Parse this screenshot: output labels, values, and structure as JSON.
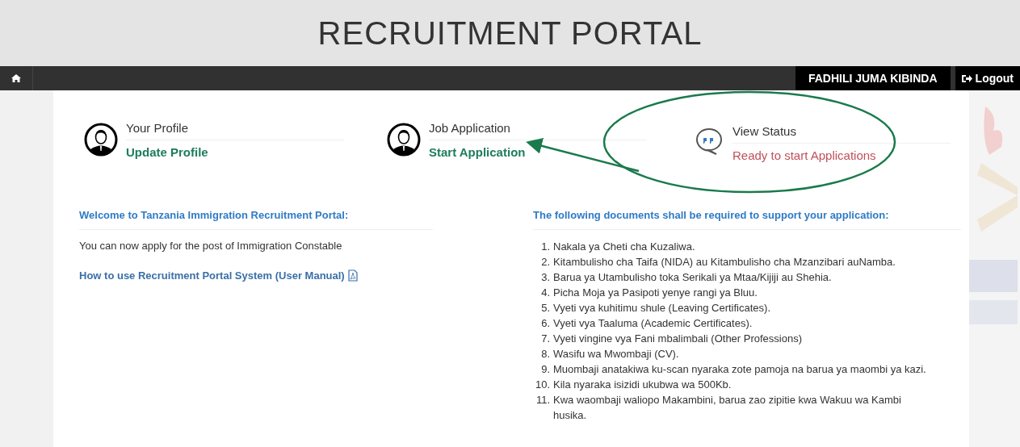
{
  "header": {
    "title": "RECRUITMENT PORTAL"
  },
  "navbar": {
    "user": "FADHILI JUMA KIBINDA",
    "logout": "Logout"
  },
  "cards": [
    {
      "kind": "profile",
      "title": "Your Profile",
      "action": "Update Profile"
    },
    {
      "kind": "profile",
      "title": "Job Application",
      "action": "Start Application"
    },
    {
      "kind": "status",
      "title": "View Status",
      "action": "Ready to start Applications"
    }
  ],
  "welcome": {
    "heading": "Welcome to Tanzania Immigration Recruitment Portal:",
    "text": "You can now apply for the post of Immigration Constable",
    "manual_link": "How to use Recruitment Portal System (User Manual)"
  },
  "documents": {
    "heading": "The following documents shall be required to support your application:",
    "items": [
      {
        "number": "1.",
        "text": "Nakala ya Cheti cha Kuzaliwa."
      },
      {
        "number": "2.",
        "text": "Kitambulisho cha Taifa (NIDA) au Kitambulisho cha Mzanzibari auNamba."
      },
      {
        "number": "3.",
        "text": "Barua ya Utambulisho toka Serikali ya Mtaa/Kijiji au Shehia."
      },
      {
        "number": "4.",
        "text": "Picha Moja ya Pasipoti yenye rangi ya Bluu."
      },
      {
        "number": "5.",
        "text": "Vyeti vya kuhitimu shule (Leaving Certificates)."
      },
      {
        "number": "6.",
        "text": "Vyeti vya Taaluma (Academic Certificates)."
      },
      {
        "number": "7.",
        "text": "Vyeti vingine vya Fani mbalimbali (Other Professions)"
      },
      {
        "number": "8.",
        "text": "Wasifu wa Mwombaji (CV)."
      },
      {
        "number": "9.",
        "text": "Muombaji anatakiwa ku-scan nyaraka zote pamoja na barua ya maombi ya kazi."
      },
      {
        "number": "10.",
        "text": "Kila nyaraka isizidi ukubwa wa 500Kb."
      },
      {
        "number": "11.",
        "text": "Kwa waombaji waliopo Makambini, barua zao zipitie kwa Wakuu wa Kambi husika."
      }
    ]
  }
}
